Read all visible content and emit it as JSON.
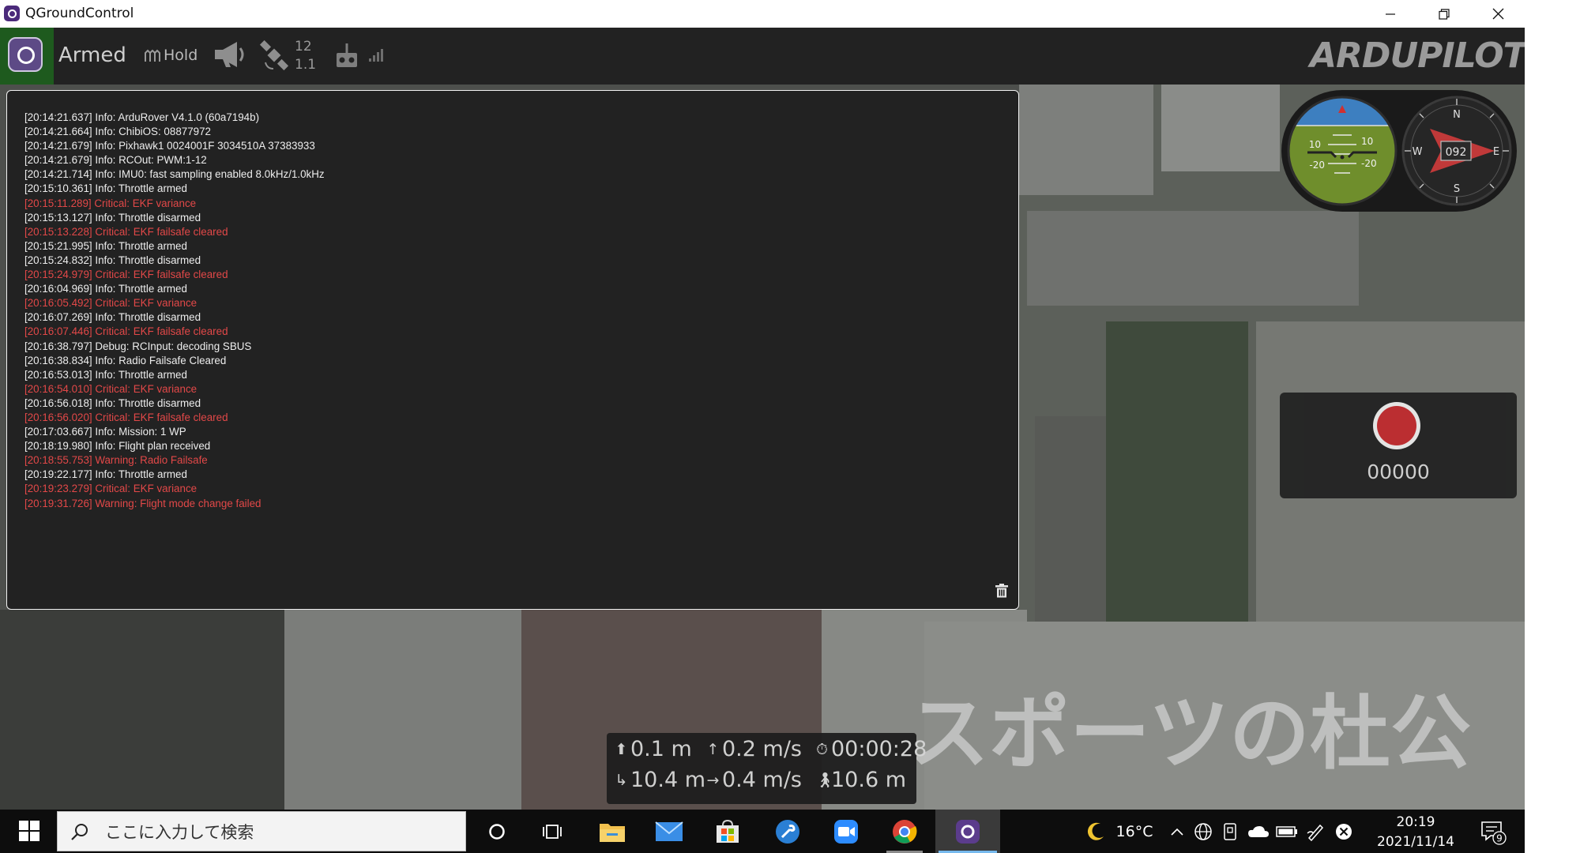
{
  "window": {
    "title": "QGroundControl"
  },
  "toolbar": {
    "armed_text": "Armed",
    "flight_mode": "Hold",
    "gps_sat_count": "12",
    "gps_hdop": "1.1",
    "brand_logo": "ARDUPILOT"
  },
  "messages": [
    {
      "text": "[20:14:21.637] Info: ArduRover V4.1.0 (60a7194b)",
      "level": "info"
    },
    {
      "text": "[20:14:21.664] Info: ChibiOS: 08877972",
      "level": "info"
    },
    {
      "text": "[20:14:21.679] Info: Pixhawk1 0024001F 3034510A 37383933",
      "level": "info"
    },
    {
      "text": "[20:14:21.679] Info: RCOut: PWM:1-12",
      "level": "info"
    },
    {
      "text": "[20:14:21.714] Info: IMU0: fast sampling enabled 8.0kHz/1.0kHz",
      "level": "info"
    },
    {
      "text": "[20:15:10.361] Info: Throttle armed",
      "level": "info"
    },
    {
      "text": "[20:15:11.289] Critical: EKF variance",
      "level": "critical"
    },
    {
      "text": "[20:15:13.127] Info: Throttle disarmed",
      "level": "info"
    },
    {
      "text": "[20:15:13.228] Critical: EKF failsafe cleared",
      "level": "critical"
    },
    {
      "text": "[20:15:21.995] Info: Throttle armed",
      "level": "info"
    },
    {
      "text": "[20:15:24.832] Info: Throttle disarmed",
      "level": "info"
    },
    {
      "text": "[20:15:24.979] Critical: EKF failsafe cleared",
      "level": "critical"
    },
    {
      "text": "[20:16:04.969] Info: Throttle armed",
      "level": "info"
    },
    {
      "text": "[20:16:05.492] Critical: EKF variance",
      "level": "critical"
    },
    {
      "text": "[20:16:07.269] Info: Throttle disarmed",
      "level": "info"
    },
    {
      "text": "[20:16:07.446] Critical: EKF failsafe cleared",
      "level": "critical"
    },
    {
      "text": "[20:16:38.797] Debug: RCInput: decoding SBUS",
      "level": "info"
    },
    {
      "text": "[20:16:38.834] Info: Radio Failsafe Cleared",
      "level": "info"
    },
    {
      "text": "[20:16:53.013] Info: Throttle armed",
      "level": "info"
    },
    {
      "text": "[20:16:54.010] Critical: EKF variance",
      "level": "critical"
    },
    {
      "text": "[20:16:56.018] Info: Throttle disarmed",
      "level": "info"
    },
    {
      "text": "[20:16:56.020] Critical: EKF failsafe cleared",
      "level": "critical"
    },
    {
      "text": "[20:17:03.667] Info: Mission: 1 WP",
      "level": "info"
    },
    {
      "text": "[20:18:19.980] Info: Flight plan received",
      "level": "info"
    },
    {
      "text": "[20:18:55.753] Warning: Radio Failsafe",
      "level": "critical"
    },
    {
      "text": "[20:19:22.177] Info: Throttle armed",
      "level": "info"
    },
    {
      "text": "[20:19:23.279] Critical: EKF variance",
      "level": "critical"
    },
    {
      "text": "[20:19:31.726] Warning: Flight mode change failed",
      "level": "critical"
    }
  ],
  "attitude": {
    "pitch_ladder": [
      "10",
      "10",
      "-20",
      "-20"
    ]
  },
  "compass": {
    "heading": "092",
    "labels": [
      "N",
      "E",
      "S",
      "W"
    ]
  },
  "video": {
    "record_time": "00000"
  },
  "telemetry": {
    "altitude": "0.1 m",
    "climb_rate": "0.2 m/s",
    "flight_time": "00:00:28",
    "distance_home": "10.4 m",
    "ground_speed": "0.4 m/s",
    "distance_travelled": "10.6 m"
  },
  "map": {
    "overlay_label": "スポーツの杜公"
  },
  "taskbar": {
    "search_placeholder": "ここに入力して検索",
    "weather": "16°C",
    "time": "20:19",
    "date": "2021/11/14",
    "notification_count": "9"
  },
  "colors": {
    "critical_text": "#e24848",
    "panel_bg": "#222222",
    "taskbar_bg": "#0d0d0d",
    "armed_toolbar_green": "#1e5a1e"
  }
}
